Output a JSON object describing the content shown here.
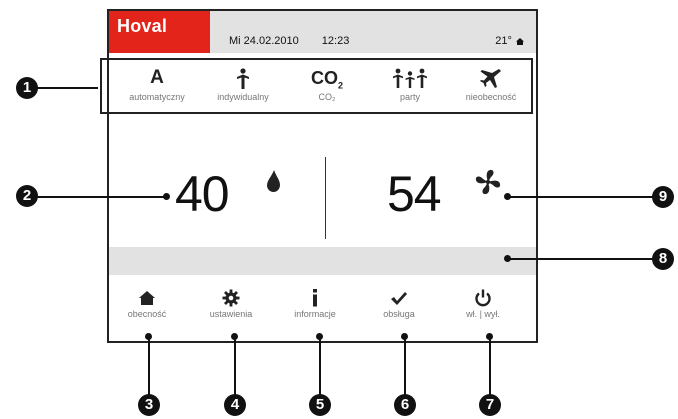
{
  "header": {
    "brand": "Hoval",
    "date": "Mi 24.02.2010",
    "time": "12:23",
    "temperature": "21°"
  },
  "modes": [
    {
      "icon": "automatic-A-icon",
      "label": "automatyczny"
    },
    {
      "icon": "person-icon",
      "label": "indywidualny"
    },
    {
      "icon": "co2-icon",
      "label": "CO₂",
      "symbol": "CO"
    },
    {
      "icon": "group-people-icon",
      "label": "party"
    },
    {
      "icon": "airplane-icon",
      "label": "nieobecność"
    }
  ],
  "values": {
    "humidity": "40",
    "fan_level": "54"
  },
  "nav": [
    {
      "icon": "home-icon",
      "label": "obecność"
    },
    {
      "icon": "gear-icon",
      "label": "ustawienia"
    },
    {
      "icon": "info-icon",
      "label": "informacje"
    },
    {
      "icon": "checkmark-icon",
      "label": "obsługa"
    },
    {
      "icon": "power-icon",
      "label": "wł. | wył."
    }
  ],
  "callouts": [
    "1",
    "2",
    "3",
    "4",
    "5",
    "6",
    "7",
    "8",
    "9"
  ],
  "colors": {
    "brand": "#e2241b",
    "bar": "#e2e2e2"
  }
}
